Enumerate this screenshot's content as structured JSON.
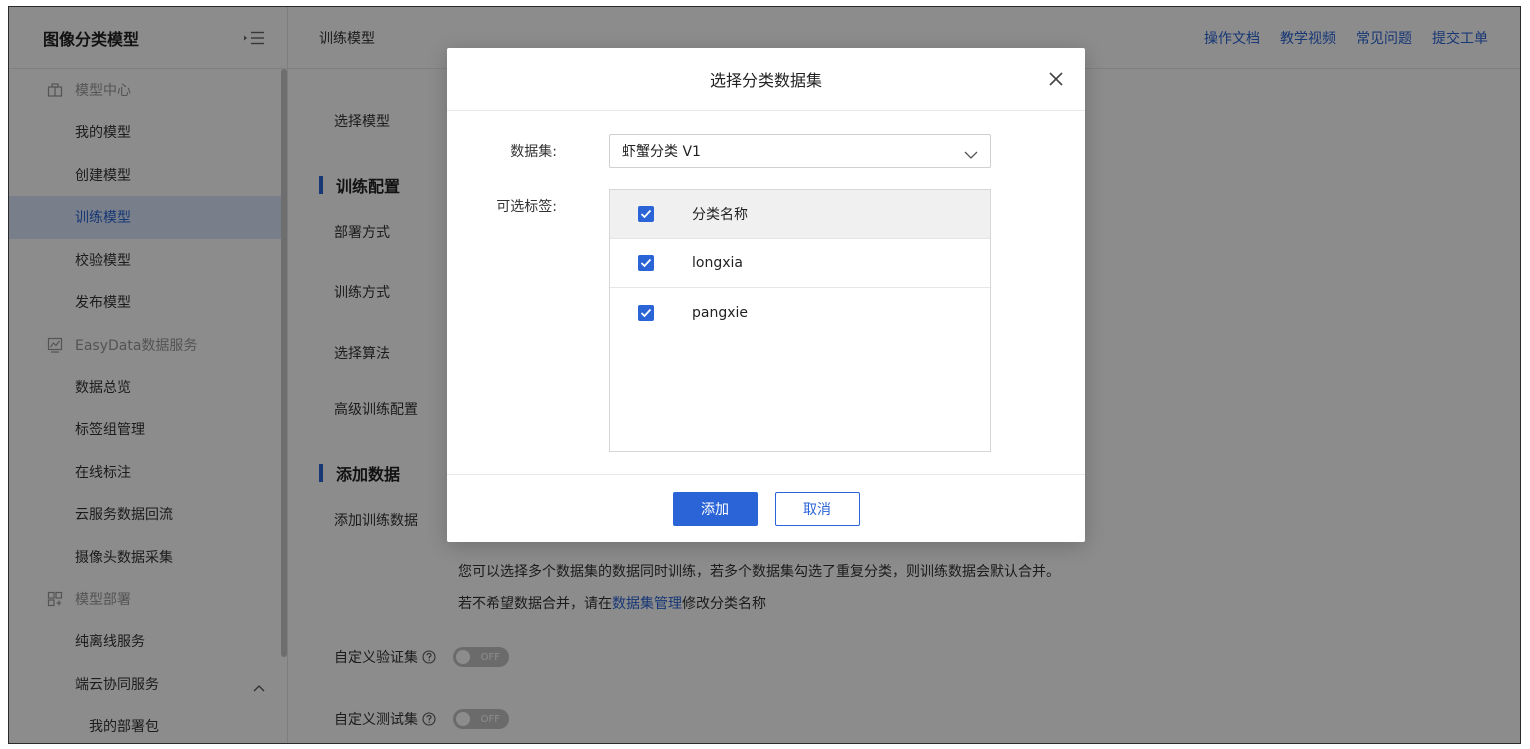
{
  "sidebar": {
    "title": "图像分类模型",
    "sections": [
      {
        "label": "模型中心",
        "icon": "model-center-icon",
        "items": [
          {
            "label": "我的模型"
          },
          {
            "label": "创建模型"
          },
          {
            "label": "训练模型",
            "active": true
          },
          {
            "label": "校验模型"
          },
          {
            "label": "发布模型"
          }
        ]
      },
      {
        "label": "EasyData数据服务",
        "icon": "data-service-icon",
        "items": [
          {
            "label": "数据总览"
          },
          {
            "label": "标签组管理"
          },
          {
            "label": "在线标注"
          },
          {
            "label": "云服务数据回流"
          },
          {
            "label": "摄像头数据采集"
          }
        ]
      },
      {
        "label": "模型部署",
        "icon": "deploy-icon",
        "items": [
          {
            "label": "纯离线服务"
          },
          {
            "label": "端云协同服务"
          },
          {
            "label": "我的部署包"
          }
        ]
      }
    ]
  },
  "topbar": {
    "breadcrumb": "训练模型",
    "links": [
      "操作文档",
      "教学视频",
      "常见问题",
      "提交工单"
    ]
  },
  "content": {
    "select_model_label": "选择模型",
    "train_config_title": "训练配置",
    "deploy_mode_label": "部署方式",
    "train_mode_label": "训练方式",
    "algorithm_label": "选择算法",
    "advanced_label": "高级训练配置",
    "add_data_title": "添加数据",
    "add_train_data_label": "添加训练数据",
    "hint_line1": "您可以选择多个数据集的数据同时训练，若多个数据集勾选了重复分类，则训练数据会默认合并。",
    "hint_line2_prefix": "若不希望数据合并，请在",
    "hint_line2_link": "数据集管理",
    "hint_line2_suffix": "修改分类名称",
    "custom_val_label": "自定义验证集",
    "custom_test_label": "自定义测试集",
    "toggle_off_text": "OFF"
  },
  "modal": {
    "title": "选择分类数据集",
    "dataset_label": "数据集:",
    "dataset_value": "虾蟹分类 V1",
    "tags_label": "可选标签:",
    "tag_header": "分类名称",
    "tags": [
      {
        "name": "longxia",
        "checked": true
      },
      {
        "name": "pangxie",
        "checked": true
      }
    ],
    "add_button": "添加",
    "cancel_button": "取消"
  },
  "colors": {
    "accent": "#2a64d6",
    "active_bg": "#dbe7fb",
    "overlay": "rgba(0,0,0,0.45)"
  }
}
